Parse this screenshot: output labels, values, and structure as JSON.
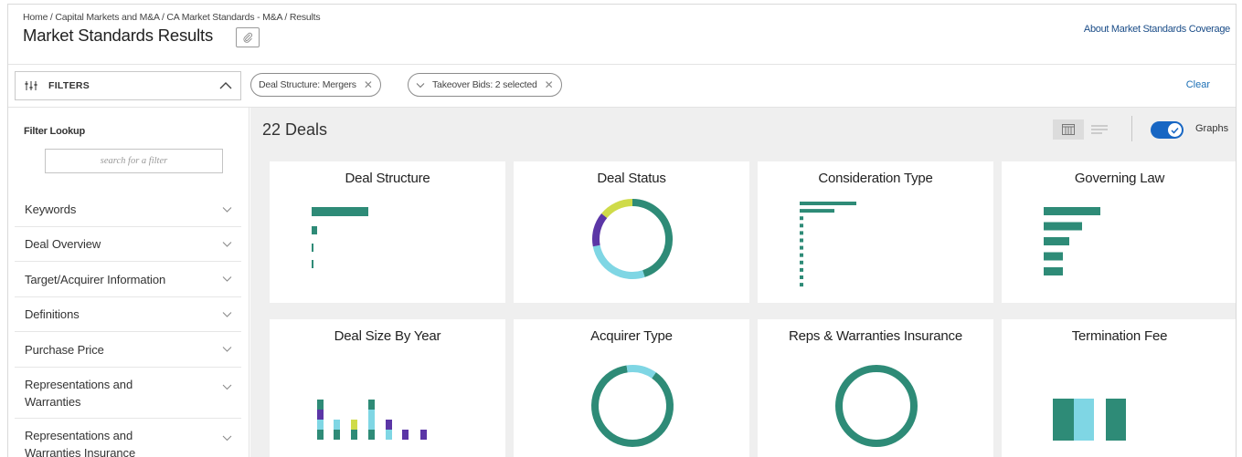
{
  "breadcrumb": "Home / Capital Markets and M&A / CA Market Standards - M&A / Results",
  "page_title": "Market Standards Results",
  "about_link": "About Market Standards Coverage",
  "filters": {
    "label": "FILTERS",
    "chips": [
      {
        "label": "Deal Structure: Mergers"
      },
      {
        "label": "Takeover Bids: 2 selected"
      }
    ],
    "clear_label": "Clear"
  },
  "sidebar": {
    "lookup_label": "Filter Lookup",
    "search_placeholder": "search for a filter",
    "items": [
      {
        "label": "Keywords"
      },
      {
        "label": "Deal Overview"
      },
      {
        "label": "Target/Acquirer Information"
      },
      {
        "label": "Definitions"
      },
      {
        "label": "Purchase Price"
      },
      {
        "label": "Representations and Warranties"
      },
      {
        "label": "Representations and Warranties Insurance"
      }
    ]
  },
  "main": {
    "deal_count": "22 Deals",
    "graphs_label": "Graphs",
    "graphs_enabled": true
  },
  "colors": {
    "teal": "#2e8b77",
    "light_blue": "#7fd6e4",
    "purple": "#5b36a6",
    "yellow_green": "#cfdb49",
    "toggle_blue": "#1766c3",
    "link_blue": "#1b4d88"
  },
  "cards": [
    {
      "title": "Deal Structure"
    },
    {
      "title": "Deal Status"
    },
    {
      "title": "Consideration Type"
    },
    {
      "title": "Governing Law"
    },
    {
      "title": "Deal Size By Year"
    },
    {
      "title": "Acquirer Type"
    },
    {
      "title": "Reps & Warranties Insurance"
    },
    {
      "title": "Termination Fee"
    }
  ],
  "chart_data": [
    {
      "type": "bar",
      "title": "Deal Structure",
      "orientation": "horizontal",
      "values": [
        62,
        6,
        2,
        2,
        2
      ],
      "color": "#2e8b77"
    },
    {
      "type": "pie",
      "title": "Deal Status",
      "donut": true,
      "slices": [
        {
          "value": 45,
          "color": "#2e8b77"
        },
        {
          "value": 27,
          "color": "#7fd6e4"
        },
        {
          "value": 14,
          "color": "#5b36a6"
        },
        {
          "value": 14,
          "color": "#cfdb49"
        }
      ]
    },
    {
      "type": "bar",
      "title": "Consideration Type",
      "orientation": "horizontal",
      "values": [
        62,
        38,
        4,
        4,
        4,
        4,
        4,
        4,
        4,
        4,
        4,
        4
      ],
      "color": "#2e8b77"
    },
    {
      "type": "bar",
      "title": "Governing Law",
      "orientation": "horizontal",
      "values": [
        62,
        42,
        28,
        21,
        21
      ],
      "color": "#2e8b77"
    },
    {
      "type": "bar",
      "title": "Deal Size By Year",
      "stacked": true,
      "series": [
        {
          "name": "teal",
          "color": "#2e8b77",
          "values": [
            2,
            2,
            2,
            2,
            0,
            0,
            0,
            0
          ]
        },
        {
          "name": "light_blue",
          "color": "#7fd6e4",
          "values": [
            2,
            2,
            0,
            4,
            2,
            0,
            0,
            0
          ]
        },
        {
          "name": "purple",
          "color": "#5b36a6",
          "values": [
            2,
            0,
            0,
            0,
            2,
            2,
            2,
            0
          ]
        },
        {
          "name": "yellow_green",
          "color": "#cfdb49",
          "values": [
            0,
            0,
            2,
            0,
            0,
            0,
            0,
            0
          ]
        },
        {
          "name": "teal_top",
          "color": "#2e8b77",
          "values": [
            2,
            0,
            0,
            2,
            0,
            0,
            0,
            0
          ]
        }
      ]
    },
    {
      "type": "pie",
      "title": "Acquirer Type",
      "donut": true,
      "slices": [
        {
          "value": 88,
          "color": "#2e8b77"
        },
        {
          "value": 12,
          "color": "#7fd6e4"
        }
      ]
    },
    {
      "type": "pie",
      "title": "Reps & Warranties Insurance",
      "donut": true,
      "slices": [
        {
          "value": 100,
          "color": "#2e8b77"
        }
      ]
    },
    {
      "type": "bar",
      "title": "Termination Fee",
      "values": [
        1,
        1,
        1
      ],
      "colors": [
        "#2e8b77",
        "#7fd6e4",
        "#2e8b77"
      ]
    }
  ]
}
